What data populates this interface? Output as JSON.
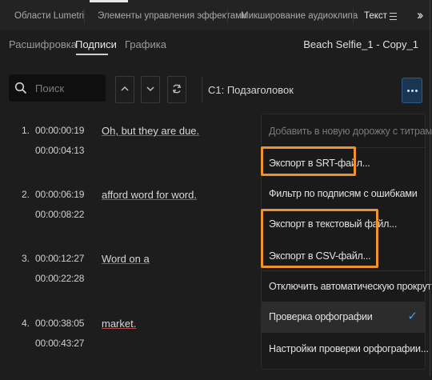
{
  "top_tabs": [
    {
      "label": "Области Lumetri"
    },
    {
      "label": "Элементы управления эффектами"
    },
    {
      "label": "Микширование аудиоклипа"
    },
    {
      "label": "Текст"
    }
  ],
  "sub_tabs": [
    {
      "label": "Расшифровка"
    },
    {
      "label": "Подписи"
    },
    {
      "label": "Графика"
    }
  ],
  "filename": "Beach Selfie_1 - Copy_1",
  "search": {
    "placeholder": "Поиск",
    "value": ""
  },
  "track_label": "C1: Подзаголовок",
  "captions": [
    {
      "num": "1.",
      "start": "00:00:00:19",
      "end": "00:00:04:13",
      "text": "Oh, but they are due."
    },
    {
      "num": "2.",
      "start": "00:00:06:19",
      "end": "00:00:08:22",
      "text": "afford word for word."
    },
    {
      "num": "3.",
      "start": "00:00:12:27",
      "end": "00:00:22:28",
      "text": "Word on a"
    },
    {
      "num": "4.",
      "start": "00:00:38:05",
      "end": "00:00:43:27",
      "text": "market."
    }
  ],
  "menu": {
    "items": [
      {
        "label": "Добавить в новую дорожку с титрами ...",
        "enabled": false
      },
      {
        "label": "Экспорт в SRT-файл...",
        "enabled": true
      },
      {
        "label": "Фильтр по подписям с ошибками",
        "enabled": true
      },
      {
        "label": "Экспорт в текстовый файл...",
        "enabled": true
      },
      {
        "label": "Экспорт в CSV-файл...",
        "enabled": true
      },
      {
        "label": "Отключить автоматическую прокрутку",
        "enabled": true
      },
      {
        "label": "Проверка орфографии",
        "enabled": true,
        "checked": true
      },
      {
        "label": "Настройки проверки орфографии...",
        "enabled": true
      }
    ]
  },
  "colors": {
    "highlight_box": "#f0922b",
    "accent": "#4a9cf0",
    "spell_underline": "#b94848"
  },
  "icons": [
    "search-icon",
    "arrow-up-icon",
    "arrow-down-icon",
    "refresh-icon",
    "more-icon",
    "checkmark-icon",
    "panel-menu-icon",
    "overflow-chevron-icon"
  ]
}
